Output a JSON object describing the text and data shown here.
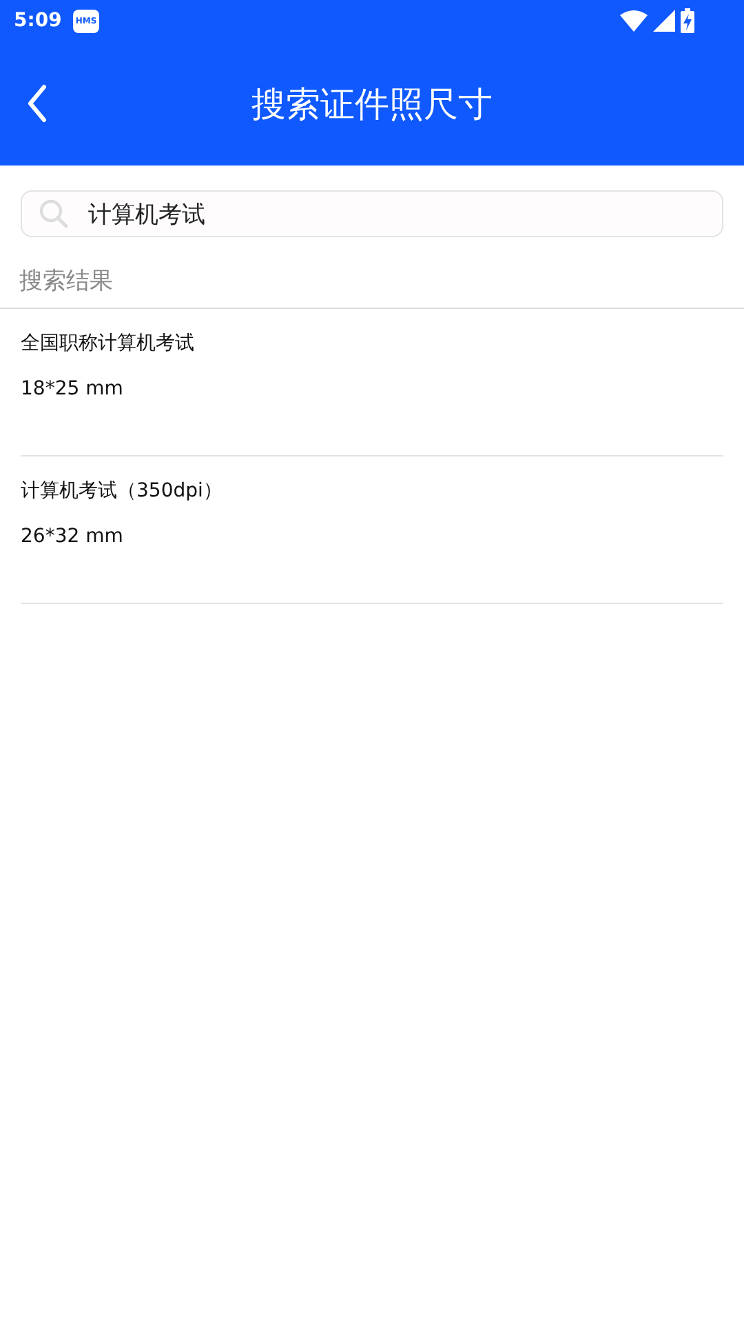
{
  "status_bar": {
    "time": "5:09",
    "notification_icon_text": "HMS"
  },
  "header": {
    "title": "搜索证件照尺寸"
  },
  "search": {
    "value": "计算机考试"
  },
  "section_label": "搜索结果",
  "results": [
    {
      "name": "全国职称计算机考试",
      "size": "18*25 mm"
    },
    {
      "name": "计算机考试（350dpi）",
      "size": "26*32 mm"
    }
  ]
}
